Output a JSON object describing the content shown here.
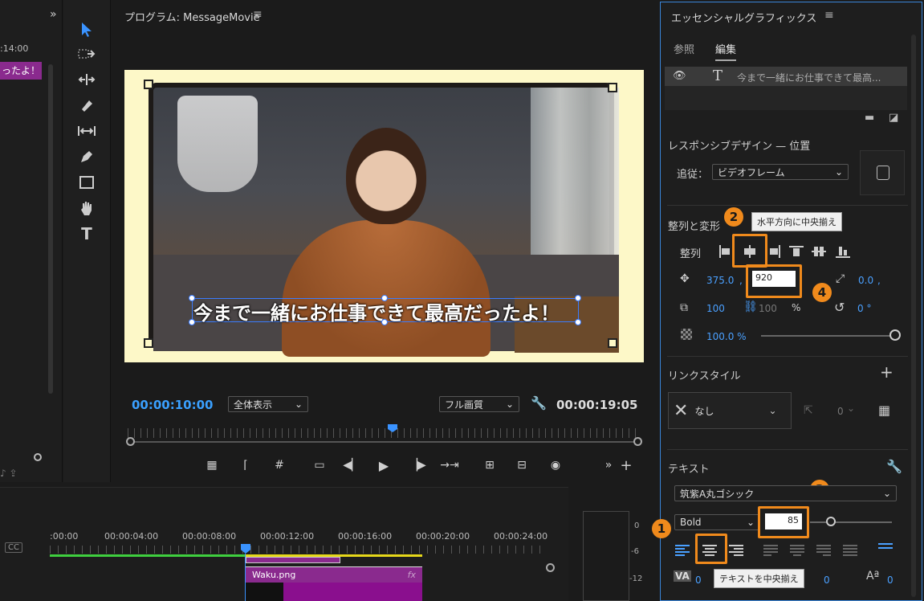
{
  "left_panel": {
    "timecode": ":14:00",
    "clip_label": "ったよ！"
  },
  "program": {
    "title": "プログラム: MessageMovie",
    "caption": "今まで一緒にお仕事できて最高だったよ！",
    "current_time": "00:00:10:00",
    "zoom_select": "全体表示",
    "quality_select": "フル画質",
    "duration": "00:00:19:05"
  },
  "timeline": {
    "ruler": [
      ":00:00",
      "00:00:04:00",
      "00:00:08:00",
      "00:00:12:00",
      "00:00:16:00",
      "00:00:20:00",
      "00:00:24:00"
    ],
    "clip_label": "Waku.png",
    "clip_fx": "fx",
    "cc_label": "CC"
  },
  "meter": {
    "labels": [
      "0",
      "-6",
      "-12"
    ]
  },
  "essential_graphics": {
    "title": "エッセンシャルグラフィックス",
    "tabs": [
      "参照",
      "編集"
    ],
    "layer_text": "今まで一緒にお仕事できて最高...",
    "responsive_label": "レスポンシブデザイン — 位置",
    "follow_label": "追従：",
    "follow_value": "ビデオフレーム",
    "align_transform_label": "整列と変形",
    "align_label": "整列",
    "tooltip_align": "水平方向に中央揃え",
    "pos_x": "375.0",
    "pos_comma": ",",
    "pos_y_input": "920",
    "anchor_x": "0.0",
    "anchor_comma": ",",
    "scale": "100",
    "scale_locked": "100",
    "scale_unit": "%",
    "rotation": "0 °",
    "opacity": "100.0 %",
    "link_style_label": "リンクスタイル",
    "style_value": "なし",
    "style_count": "0",
    "text_label": "テキスト",
    "font_value": "筑紫A丸ゴシック",
    "font_style": "Bold",
    "font_size_input": "85",
    "tooltip_text_center": "テキストを中央揃え",
    "tracking_value": "0",
    "kerning_value": "0",
    "baseline_value": "0",
    "badges": [
      "1",
      "2",
      "3",
      "4"
    ]
  },
  "colors": {
    "accent_blue": "#3aa0ff",
    "highlight_orange": "#f08a1c",
    "clip_purple": "#8a2a8e",
    "panel_border": "#3a85d9"
  }
}
